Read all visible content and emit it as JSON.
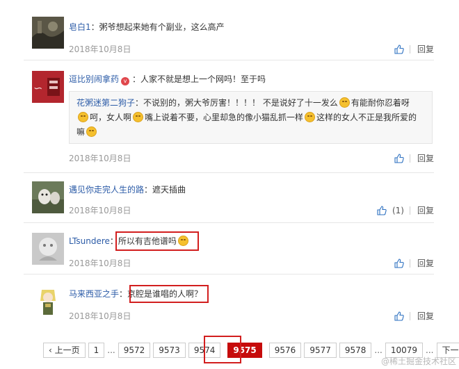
{
  "comments": [
    {
      "username": "皂白1",
      "separator": "：",
      "text": "粥爷想起来她有个副业，这么高产",
      "date": "2018年10月8日",
      "reply_label": "回复"
    },
    {
      "username": "逗比别闹拿药",
      "badge": "v",
      "separator": "：",
      "text": "人家不就是想上一个网吗！至于吗",
      "quote": {
        "username": "花粥迷第二狗子",
        "separator": "：",
        "seg1": "不说别的，粥大爷厉害！！！！ 不是说好了十一发么",
        "seg2": "有能耐你忍着呀",
        "seg3": "呵，女人啊",
        "seg4": "嘴上说着不要，心里却急的像小猫乱抓一样",
        "seg5": "这样的女人不正是我所爱的嘛"
      },
      "date": "2018年10月8日",
      "reply_label": "回复"
    },
    {
      "username": "遇见你走完人生的路",
      "separator": "：",
      "text": "遮天插曲",
      "date": "2018年10月8日",
      "like_count": "(1)",
      "reply_label": "回复"
    },
    {
      "username": "LTsundere",
      "separator": "：",
      "text": "所以有吉他谱吗",
      "date": "2018年10月8日",
      "reply_label": "回复"
    },
    {
      "username": "马来西亚之手",
      "separator": "：",
      "text": "京腔是谁唱的人啊？",
      "date": "2018年10月8日",
      "reply_label": "回复"
    }
  ],
  "pagination": {
    "prev": "‹ 上一页",
    "first": "1",
    "ellipsis": "...",
    "pages": [
      "9572",
      "9573",
      "9574",
      "9575",
      "9576",
      "9577",
      "9578"
    ],
    "current": "9575",
    "last": "10079",
    "next": "下一页 ›"
  },
  "watermark": "@稀土掘金技术社区",
  "colors": {
    "accent_red": "#c60b0b",
    "link_blue": "#2b5ba7",
    "highlight_box": "#d21e1e"
  },
  "icons": {
    "like": "thumbs-up-icon",
    "emoji": "smiley-emoji-icon"
  }
}
